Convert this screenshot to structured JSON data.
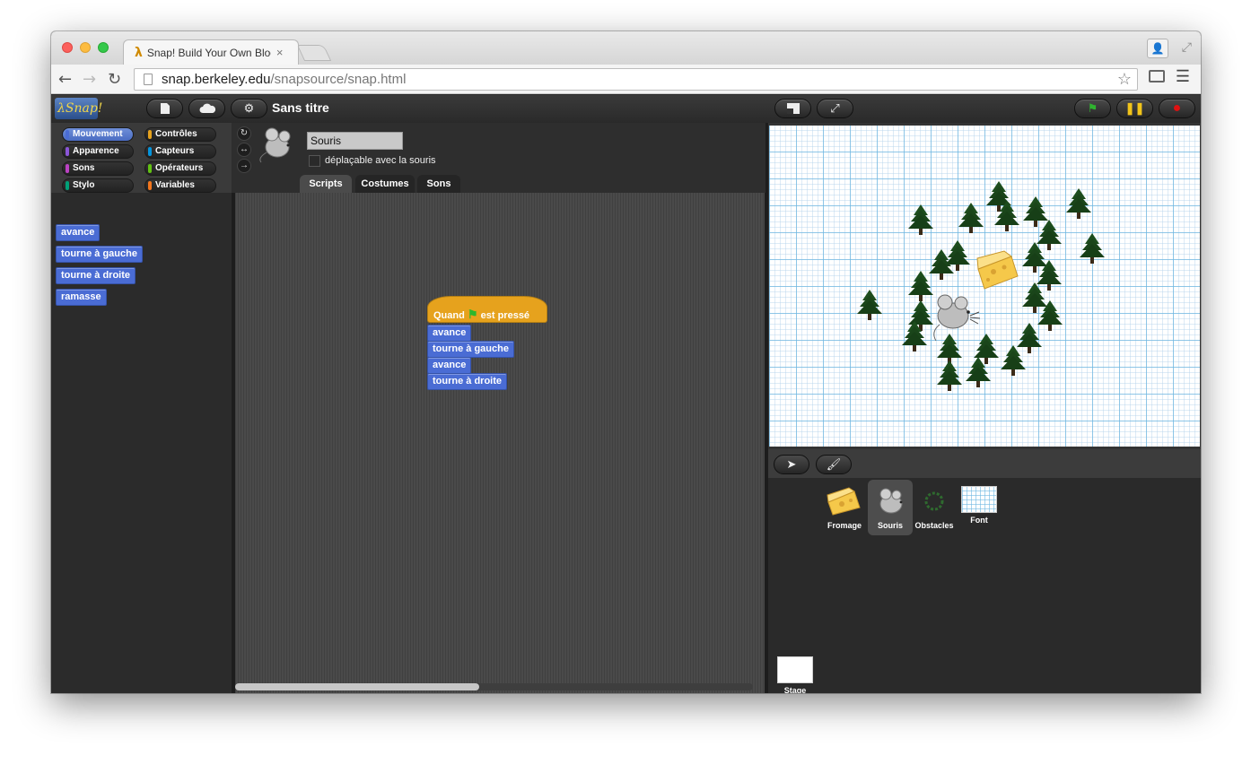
{
  "browser": {
    "tab_title": "Snap! Build Your Own Block",
    "tab_icon": "λ",
    "tab_close": "×",
    "url_host": "snap.berkeley.edu",
    "url_path": "/snapsource/snap.html"
  },
  "snap": {
    "logo_text": "λSnap!",
    "project_title": "Sans titre",
    "categories": [
      {
        "label": "Mouvement",
        "color": "#4a6cd4",
        "active": true
      },
      {
        "label": "Contrôles",
        "color": "#e6a21d"
      },
      {
        "label": "Apparence",
        "color": "#8a55d7"
      },
      {
        "label": "Capteurs",
        "color": "#0494dc"
      },
      {
        "label": "Sons",
        "color": "#bb42c3"
      },
      {
        "label": "Opérateurs",
        "color": "#62c213"
      },
      {
        "label": "Stylo",
        "color": "#00a178"
      },
      {
        "label": "Variables",
        "color": "#f3761d"
      }
    ],
    "palette_blocks": [
      "avance",
      "tourne à gauche",
      "tourne à droite",
      "ramasse"
    ],
    "sprite": {
      "name": "Souris",
      "draggable_label": "déplaçable avec la souris"
    },
    "editor_tabs": [
      "Scripts",
      "Costumes",
      "Sons"
    ],
    "script": {
      "hat_prefix": "Quand",
      "hat_suffix": "est pressé",
      "blocks": [
        "avance",
        "tourne à gauche",
        "avance",
        "tourne à droite"
      ]
    },
    "corral": {
      "sprites": [
        {
          "label": "Fromage"
        },
        {
          "label": "Souris",
          "selected": true
        },
        {
          "label": "Obstacles"
        },
        {
          "label": "Font"
        }
      ],
      "stage_label": "Stage"
    }
  },
  "icons": {
    "back": "back-arrow-icon",
    "forward": "forward-arrow-icon",
    "reload": "reload-icon",
    "star": "star-icon",
    "menu": "hamburger-menu-icon",
    "green_flag": "green-flag-icon",
    "pause": "pause-icon",
    "stop": "stop-icon"
  }
}
